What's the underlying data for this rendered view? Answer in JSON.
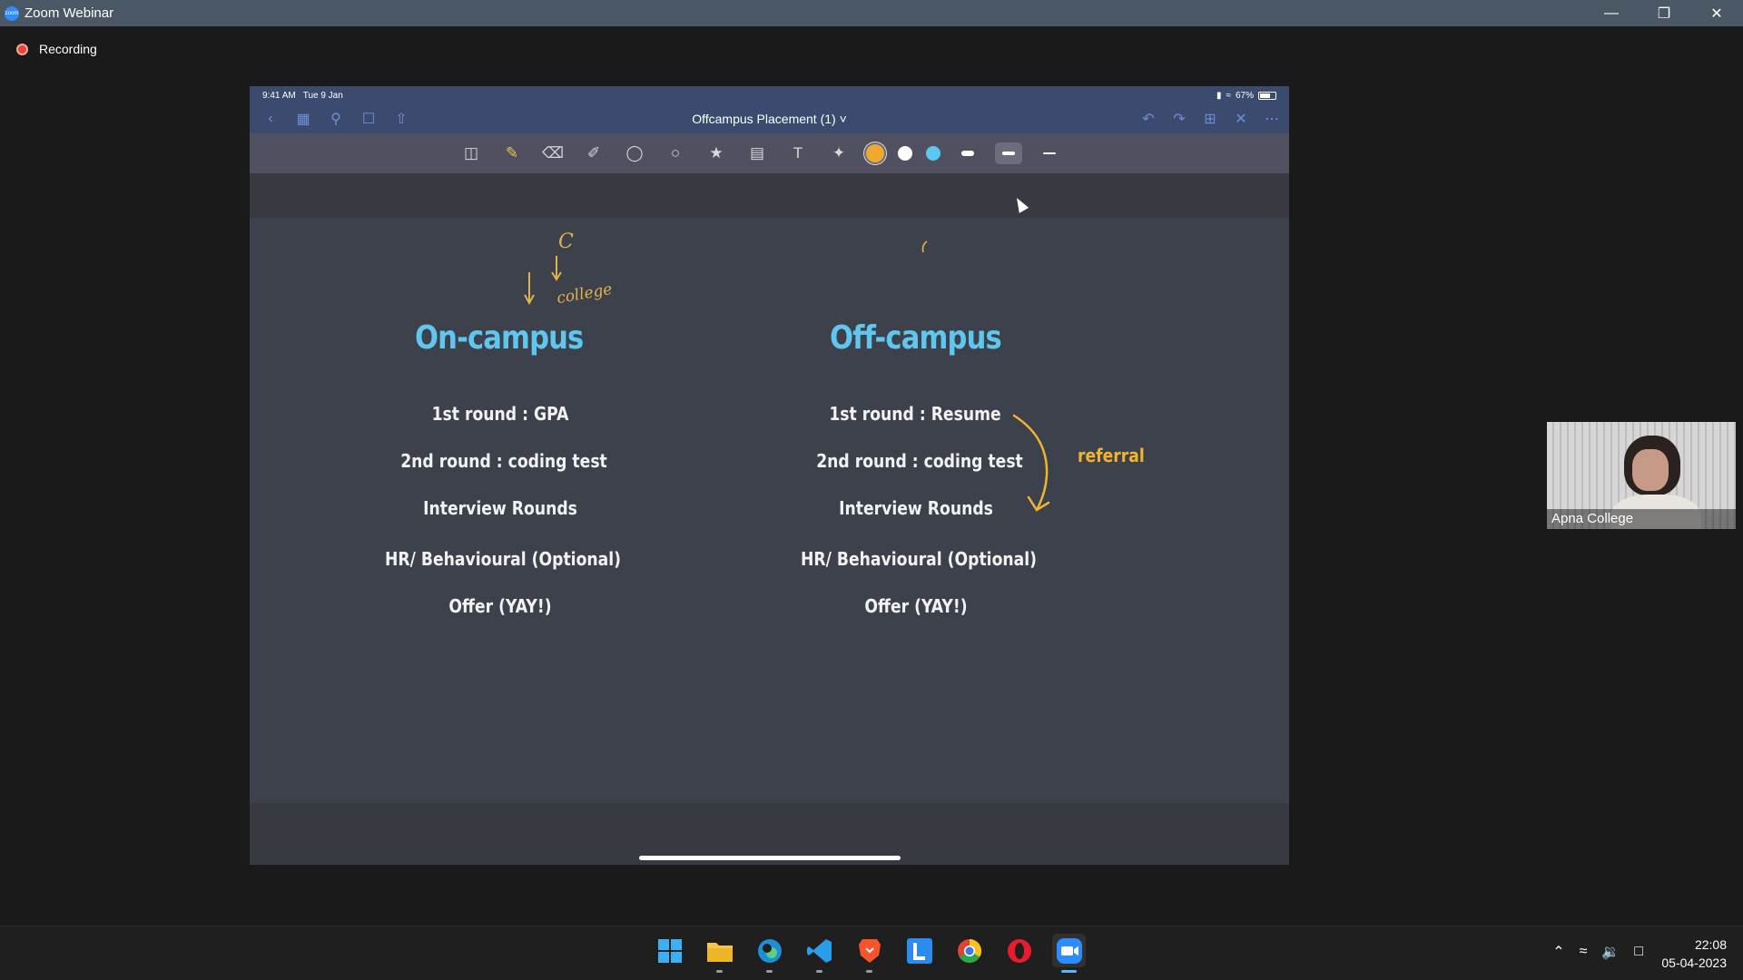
{
  "window": {
    "title": "Zoom Webinar",
    "recording_label": "Recording"
  },
  "ipad": {
    "status_time": "9:41 AM",
    "status_date": "Tue 9 Jan",
    "battery": "67%",
    "doc_title": "Offcampus Placement (1) ˅"
  },
  "slide": {
    "on_campus": {
      "heading": "On-campus",
      "items": [
        "1st round : GPA",
        "2nd  round : coding test",
        "Interview Rounds",
        "HR/ Behavioural (Optional)",
        "Offer (YAY!)"
      ]
    },
    "off_campus": {
      "heading": "Off-campus",
      "items": [
        "1st round : Resume",
        "2nd  round : coding test",
        "Interview Rounds",
        "HR/ Behavioural (Optional)",
        "Offer (YAY!)"
      ]
    },
    "annotation": "referral",
    "handwriting_college": "college",
    "handwriting_c": "C"
  },
  "participant": {
    "name": "Apna College"
  },
  "taskbar": {
    "time": "22:08",
    "date": "05-04-2023"
  },
  "colors": {
    "heading": "#5fc7ee",
    "annotation": "#f0b430",
    "swatch_orange": "#f0a830",
    "swatch_blue": "#5bc8f0"
  }
}
